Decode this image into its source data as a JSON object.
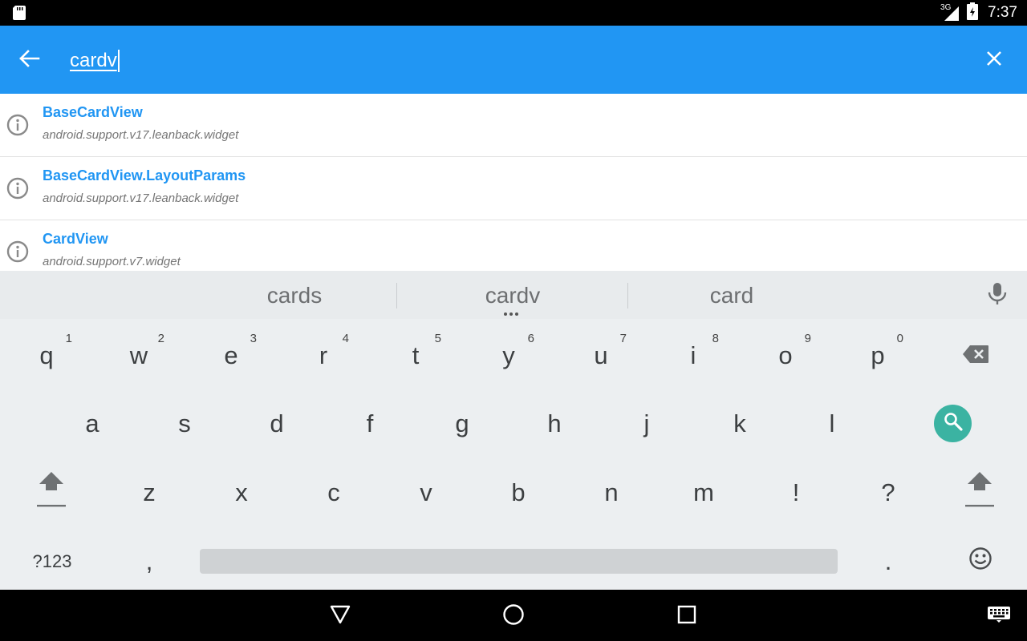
{
  "status_bar": {
    "network_type": "3G",
    "time": "7:37"
  },
  "search": {
    "query": "cardv",
    "back_icon": "arrow-back-icon",
    "clear_icon": "close-icon",
    "bar_color": "#2196f3"
  },
  "results": [
    {
      "title": "BaseCardView",
      "package": "android.support.v17.leanback.widget",
      "icon": "info-icon"
    },
    {
      "title": "BaseCardView.LayoutParams",
      "package": "android.support.v17.leanback.widget",
      "icon": "info-icon"
    },
    {
      "title": "CardView",
      "package": "android.support.v7.widget",
      "icon": "info-icon"
    }
  ],
  "keyboard": {
    "suggestions": [
      "cards",
      "cardv",
      "card"
    ],
    "row1": [
      {
        "label": "q",
        "hint": "1"
      },
      {
        "label": "w",
        "hint": "2"
      },
      {
        "label": "e",
        "hint": "3"
      },
      {
        "label": "r",
        "hint": "4"
      },
      {
        "label": "t",
        "hint": "5"
      },
      {
        "label": "y",
        "hint": "6"
      },
      {
        "label": "u",
        "hint": "7"
      },
      {
        "label": "i",
        "hint": "8"
      },
      {
        "label": "o",
        "hint": "9"
      },
      {
        "label": "p",
        "hint": "0"
      }
    ],
    "row2": [
      "a",
      "s",
      "d",
      "f",
      "g",
      "h",
      "j",
      "k",
      "l"
    ],
    "row3": [
      "z",
      "x",
      "c",
      "v",
      "b",
      "n",
      "m",
      "!",
      "?"
    ],
    "row4": {
      "symbols": "?123",
      "comma": ",",
      "period": "."
    },
    "accent_color": "#3bb3a2"
  }
}
